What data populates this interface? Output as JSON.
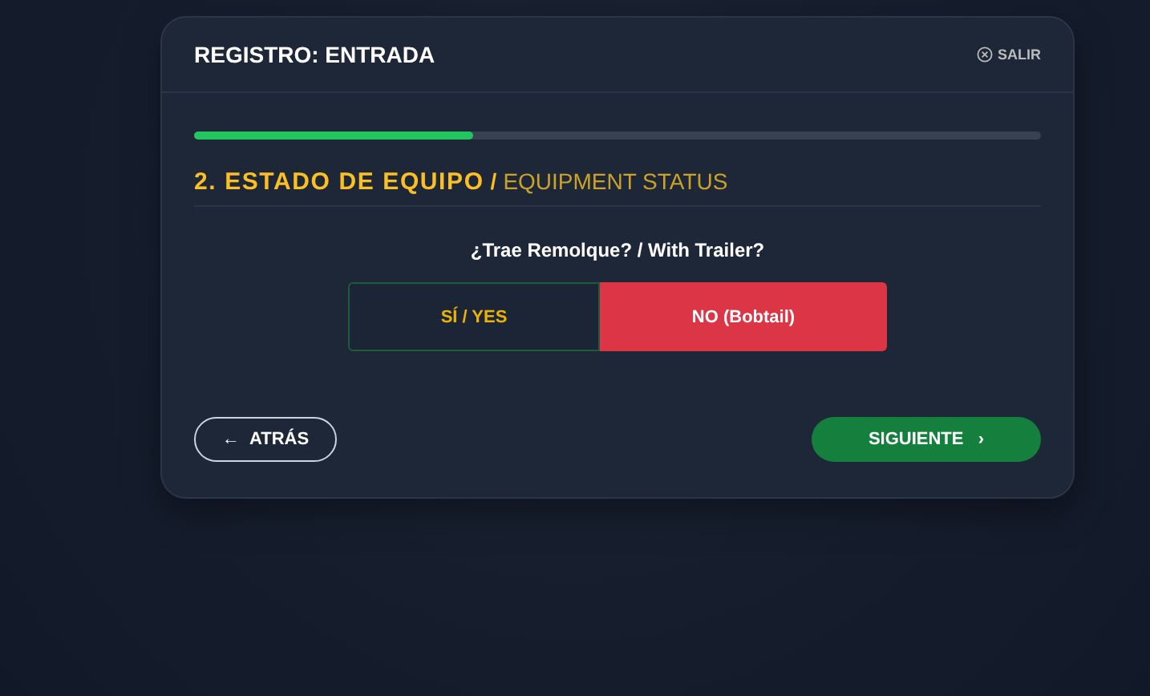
{
  "header": {
    "title": "REGISTRO: ENTRADA",
    "exit_label": "SALIR"
  },
  "progress": {
    "level": 0.33
  },
  "section": {
    "title": "2. ESTADO DE EQUIPO",
    "separator": "/",
    "subtitle": "EQUIPMENT STATUS"
  },
  "question": "¿Trae Remolque? / With Trailer?",
  "options": [
    {
      "label": "SÍ / YES",
      "selected": false
    },
    {
      "label": "NO (Bobtail)",
      "selected": true
    }
  ],
  "back_button": {
    "label": "ATRÁS",
    "arrow": "←"
  },
  "next_button": {
    "label": "SIGUIENTE",
    "arrow": "›"
  }
}
